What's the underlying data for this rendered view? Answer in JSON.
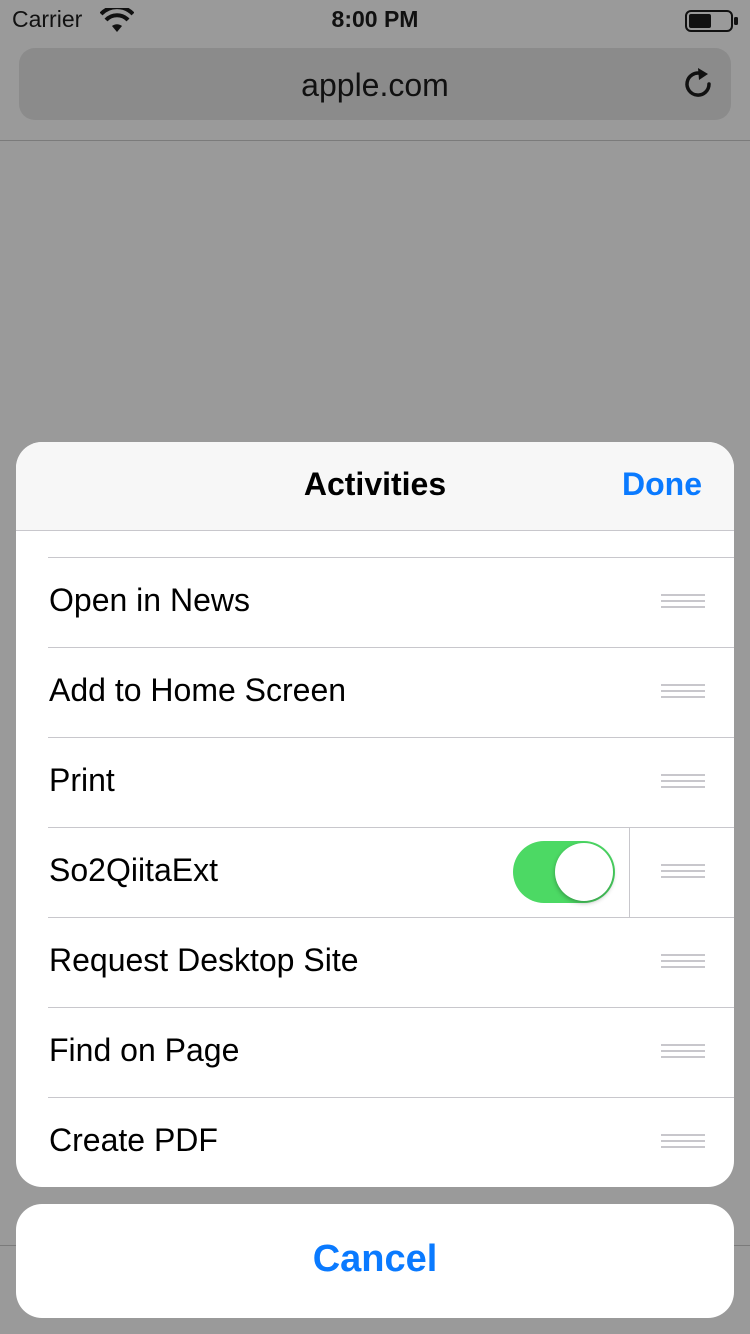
{
  "status_bar": {
    "carrier": "Carrier",
    "time": "8:00 PM"
  },
  "browser": {
    "address": "apple.com"
  },
  "sheet": {
    "title": "Activities",
    "done_label": "Done",
    "items": [
      {
        "label": "Open in News"
      },
      {
        "label": "Add to Home Screen"
      },
      {
        "label": "Print"
      },
      {
        "label": "So2QiitaExt",
        "toggle": true
      },
      {
        "label": "Request Desktop Site"
      },
      {
        "label": "Find on Page"
      },
      {
        "label": "Create PDF"
      }
    ]
  },
  "cancel_label": "Cancel",
  "colors": {
    "accent": "#0a7aff",
    "toggle_on": "#4cd964",
    "dimmed_background": "#9a9a9a"
  }
}
